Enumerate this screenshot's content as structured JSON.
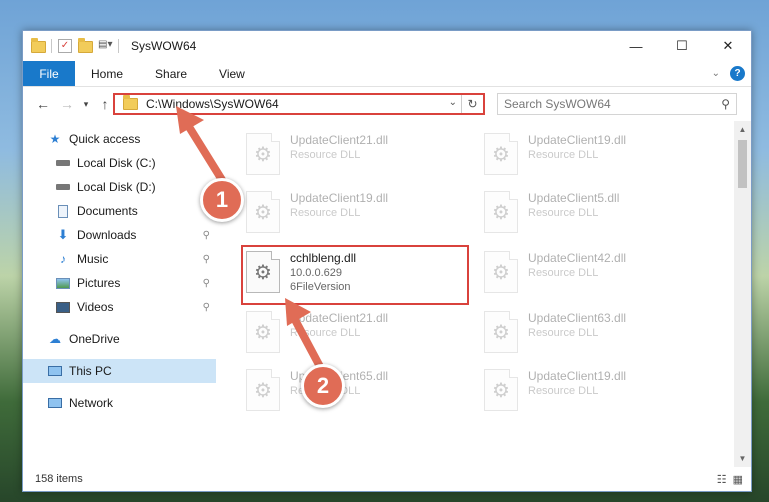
{
  "window": {
    "title": "SysWOW64"
  },
  "ribbon": {
    "tabs": [
      "File",
      "Home",
      "Share",
      "View"
    ],
    "help": "?"
  },
  "address": {
    "path": "C:\\Windows\\SysWOW64"
  },
  "search": {
    "placeholder": "Search SysWOW64"
  },
  "sidebar": {
    "items": [
      {
        "label": "Quick access",
        "icon": "star-icon"
      },
      {
        "label": "Local Disk (C:)",
        "icon": "drive-icon"
      },
      {
        "label": "Local Disk (D:)",
        "icon": "drive-icon"
      },
      {
        "label": "Documents",
        "icon": "documents-icon"
      },
      {
        "label": "Downloads",
        "icon": "download-icon"
      },
      {
        "label": "Music",
        "icon": "music-icon"
      },
      {
        "label": "Pictures",
        "icon": "pictures-icon"
      },
      {
        "label": "Videos",
        "icon": "videos-icon"
      },
      {
        "label": "OneDrive",
        "icon": "cloud-icon"
      },
      {
        "label": "This PC",
        "icon": "monitor-icon"
      },
      {
        "label": "Network",
        "icon": "network-icon"
      }
    ]
  },
  "files": [
    {
      "name": "UpdateClient21.dll",
      "type": "Resource DLL"
    },
    {
      "name": "UpdateClient19.dll",
      "type": "Resource DLL"
    },
    {
      "name": "UpdateClient19.dll",
      "type": "Resource DLL"
    },
    {
      "name": "UpdateClient5.dll",
      "type": "Resource DLL"
    },
    {
      "name": "cchlbleng.dll",
      "version": "10.0.0.629",
      "type": "6FileVersion"
    },
    {
      "name": "UpdateClient42.dll",
      "type": "Resource DLL"
    },
    {
      "name": "UpdateClient21.dll",
      "type": "Resource DLL"
    },
    {
      "name": "UpdateClient63.dll",
      "type": "Resource DLL"
    },
    {
      "name": "UpdateClient65.dll",
      "type": "Resource DLL"
    },
    {
      "name": "UpdateClient19.dll",
      "type": "Resource DLL"
    }
  ],
  "status": {
    "count": "158 items"
  },
  "badges": {
    "one": "1",
    "two": "2"
  },
  "colors": {
    "accent": "#1979ca",
    "highlight": "#d9423c",
    "badge": "#e06c56"
  }
}
